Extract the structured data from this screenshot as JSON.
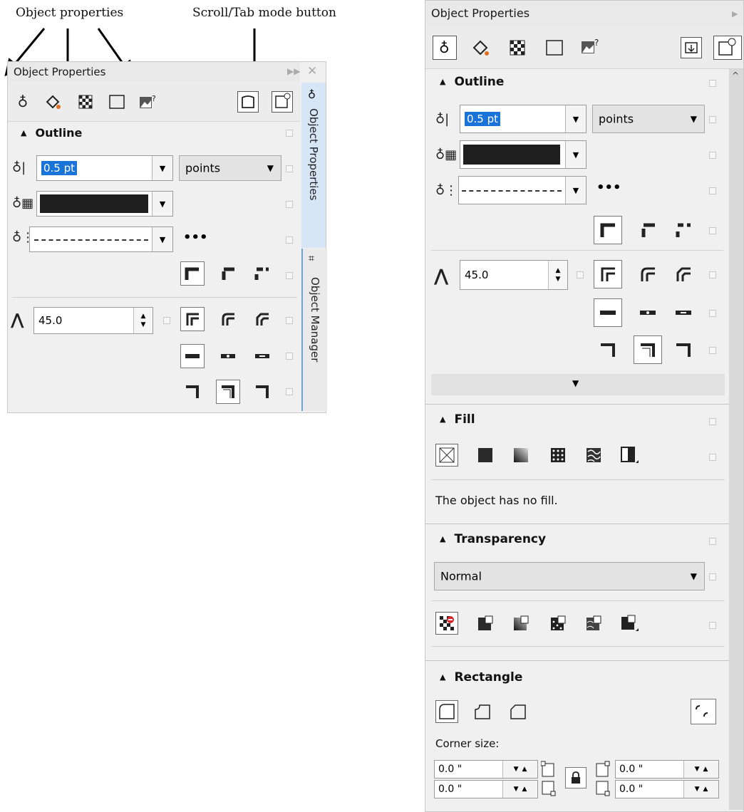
{
  "annotations": {
    "object_properties": "Object properties",
    "scroll_tab_mode": "Scroll/Tab mode button"
  },
  "left_panel": {
    "title": "Object Properties",
    "outline_label": "Outline",
    "width_value": "0.5 pt",
    "units_value": "points",
    "miter_value": "45.0",
    "side_tabs": [
      "Object Properties",
      "Object Manager"
    ]
  },
  "right_panel": {
    "title": "Object Properties",
    "outline_label": "Outline",
    "width_value": "0.5 pt",
    "units_value": "points",
    "miter_value": "45.0",
    "fill_label": "Fill",
    "fill_message": "The object has no fill.",
    "transparency_label": "Transparency",
    "transparency_mode": "Normal",
    "rectangle_label": "Rectangle",
    "corner_size_label": "Corner size:",
    "corner_values": [
      "0.0 \"",
      "0.0 \"",
      "0.0 \"",
      "0.0 \""
    ]
  },
  "icons": {
    "outline": "pen-nib-icon",
    "fill": "paint-bucket-icon",
    "transparency": "checkerboard-icon",
    "summary": "rectangle-icon",
    "image": "image-question-icon"
  },
  "colors": {
    "accent": "#1a73d9",
    "panel_bg": "#f0f0f0",
    "outline_color": "#1e1e1e",
    "side_tab_bg": "#d6e6f7"
  }
}
